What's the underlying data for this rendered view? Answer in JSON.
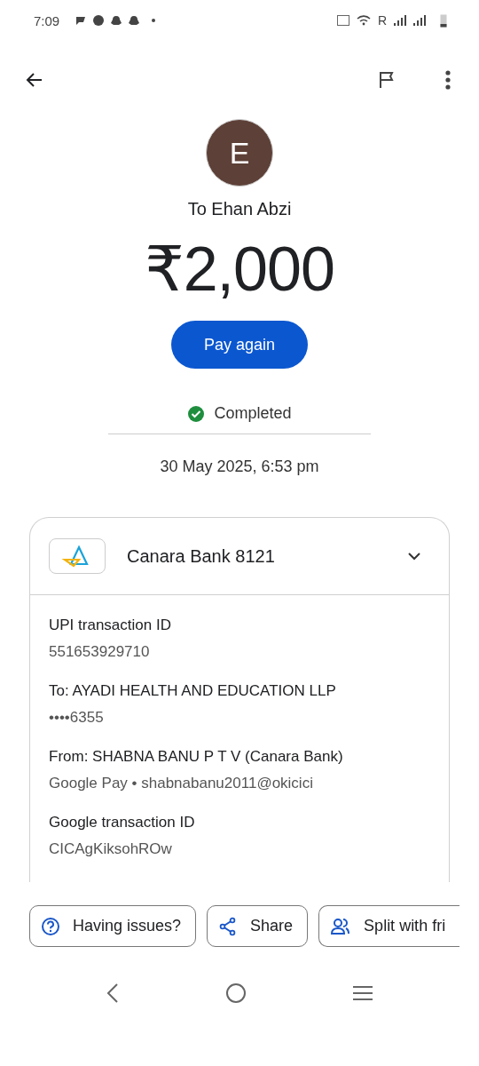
{
  "status_bar": {
    "time": "7:09",
    "roaming": "R"
  },
  "recipient": {
    "initial": "E",
    "name": "To Ehan Abzi"
  },
  "amount": "₹2,000",
  "pay_again": "Pay again",
  "status": {
    "label": "Completed",
    "kind": "completed"
  },
  "date": "30 May 2025, 6:53 pm",
  "account": {
    "name": "Canara Bank 8121",
    "expanded": true
  },
  "details": [
    {
      "label": "UPI transaction ID",
      "value": "551653929710"
    },
    {
      "label": "To: AYADI HEALTH AND EDUCATION LLP",
      "value": "••••6355"
    },
    {
      "label": "From: SHABNA BANU P T V (Canara Bank)",
      "value": "Google Pay • shabnabanu2011@okicici"
    },
    {
      "label": "Google transaction ID",
      "value": "CICAgKiksohROw"
    }
  ],
  "actions": [
    {
      "label": "Having issues?",
      "kind": "help"
    },
    {
      "label": "Share",
      "kind": "share"
    },
    {
      "label": "Split with fri",
      "kind": "split"
    }
  ]
}
